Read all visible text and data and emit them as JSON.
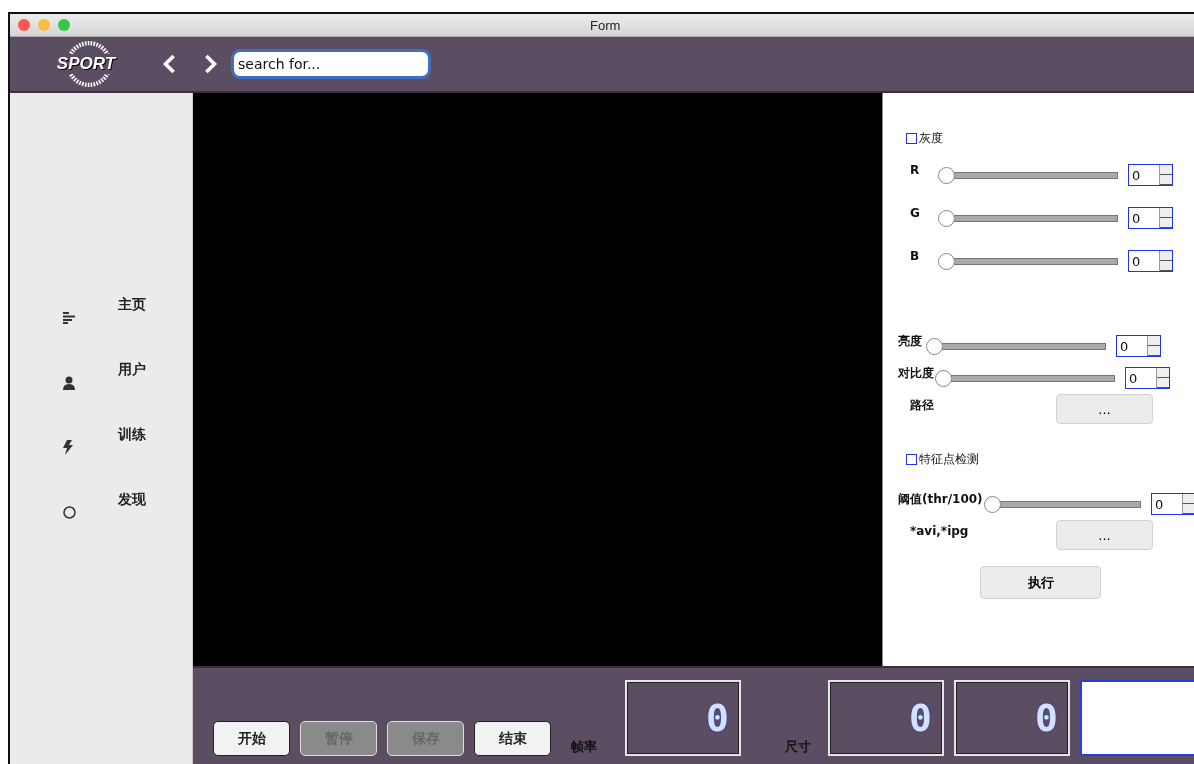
{
  "window": {
    "title": "Form"
  },
  "toolbar": {
    "logo": "SPORT",
    "search": {
      "placeholder": "search for..."
    }
  },
  "sidebar": {
    "items": [
      {
        "label": "主页",
        "kind": "bars"
      },
      {
        "label": "用户",
        "kind": "person"
      },
      {
        "label": "训练",
        "kind": "bolt"
      },
      {
        "label": "发现",
        "kind": "circle"
      }
    ]
  },
  "controls": [
    {
      "kind": "checkbox",
      "label": "灰度",
      "checked": false
    },
    {
      "kind": "slider",
      "label": "R",
      "level": 0,
      "value": "0"
    },
    {
      "kind": "slider",
      "label": "G",
      "level": 0,
      "value": "0"
    },
    {
      "kind": "slider",
      "label": "B",
      "level": 0,
      "value": "0"
    },
    {
      "kind": "spacer"
    },
    {
      "kind": "slider",
      "label": "亮度",
      "level": 0,
      "value": "0"
    },
    {
      "kind": "slider",
      "label": "对比度",
      "level": 0,
      "value": "0"
    },
    {
      "kind": "button",
      "label": "路径",
      "button": "..."
    },
    {
      "kind": "checkbox",
      "label": "特征点检测",
      "checked": false
    },
    {
      "kind": "slider",
      "label": "阈值(thr/100)",
      "level": 0,
      "value": "0"
    },
    {
      "kind": "button",
      "label": "*avi,*ipg",
      "button": "..."
    },
    {
      "kind": "action",
      "button": "执行"
    }
  ],
  "bottom": {
    "buttons": [
      {
        "label": "开始",
        "disabled": false
      },
      {
        "label": "暂停",
        "disabled": true
      },
      {
        "label": "保存",
        "disabled": true
      },
      {
        "label": "结束",
        "disabled": false
      }
    ],
    "fps": {
      "label": "帧率",
      "display": "0"
    },
    "size": {
      "label": "尺寸",
      "displays": [
        "0",
        "0"
      ]
    }
  }
}
